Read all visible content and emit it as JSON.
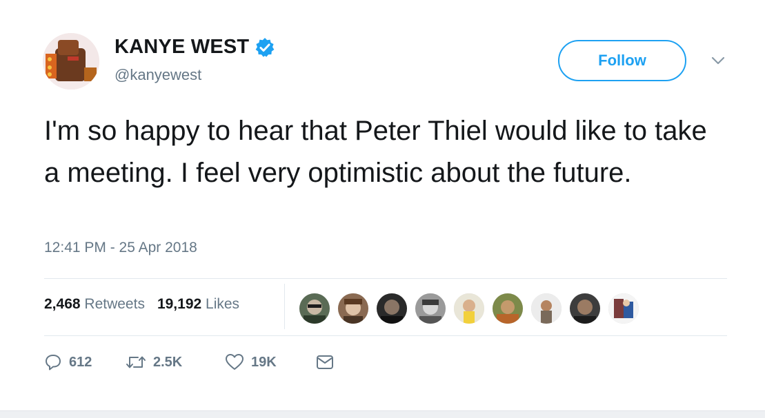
{
  "user": {
    "display_name": "KANYE WEST",
    "handle": "@kanyewest",
    "verified": true
  },
  "follow_button": {
    "label": "Follow"
  },
  "tweet": {
    "text": "I'm so happy to hear that Peter Thiel would like to take a meeting. I feel very optimistic about the future.",
    "timestamp": "12:41 PM - 25 Apr 2018"
  },
  "stats": {
    "retweets_count": "2,468",
    "retweets_label": "Retweets",
    "likes_count": "19,192",
    "likes_label": "Likes"
  },
  "actions": {
    "reply_count": "612",
    "retweet_count": "2.5K",
    "like_count": "19K"
  },
  "icons": {
    "verified": "verified-badge-icon",
    "more": "chevron-down-icon",
    "reply": "reply-icon",
    "retweet": "retweet-icon",
    "like": "heart-icon",
    "dm": "envelope-icon"
  },
  "colors": {
    "accent": "#1da1f2",
    "text_primary": "#14171a",
    "text_secondary": "#657786",
    "divider": "#e1e8ed"
  }
}
